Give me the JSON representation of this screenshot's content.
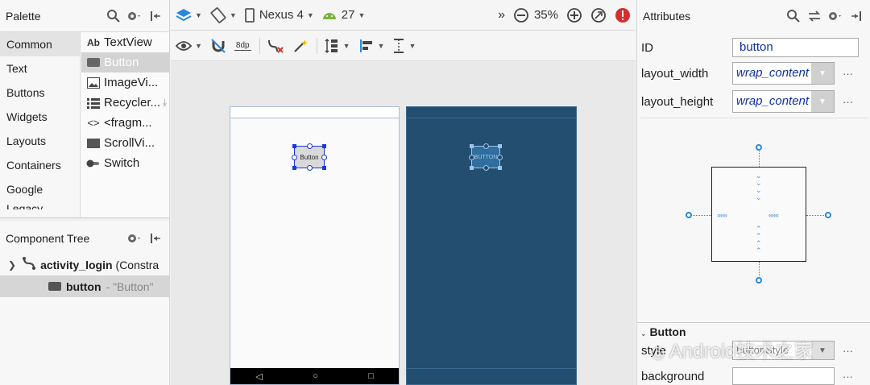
{
  "palette": {
    "title": "Palette",
    "categories": [
      "Common",
      "Text",
      "Buttons",
      "Widgets",
      "Layouts",
      "Containers",
      "Google",
      "Legacy"
    ],
    "selected_category": "Common",
    "items": [
      {
        "label": "TextView",
        "icon": "textview-icon"
      },
      {
        "label": "Button",
        "icon": "button-icon"
      },
      {
        "label": "ImageVi...",
        "icon": "image-icon"
      },
      {
        "label": "Recycler...",
        "icon": "list-icon"
      },
      {
        "label": "<fragm...",
        "icon": "fragment-icon"
      },
      {
        "label": "ScrollVi...",
        "icon": "scrollview-icon"
      },
      {
        "label": "Switch",
        "icon": "switch-icon"
      }
    ],
    "selected_item": "Button"
  },
  "component_tree": {
    "title": "Component Tree",
    "root": {
      "name": "activity_login",
      "type": "(Constra"
    },
    "child": {
      "name": "button",
      "text": "- \"Button\""
    }
  },
  "toolbar": {
    "device": "Nexus 4",
    "api": "27",
    "zoom": "35%",
    "margin": "8dp"
  },
  "preview": {
    "design_button_label": "Button",
    "blueprint_button_label": "BUTTON"
  },
  "attributes": {
    "title": "Attributes",
    "id_label": "ID",
    "id_value": "button",
    "width_label": "layout_width",
    "width_value": "wrap_content",
    "height_label": "layout_height",
    "height_value": "wrap_content",
    "section_title": "Button",
    "style_label": "style",
    "style_value": "buttonStyle",
    "background_label": "background"
  },
  "watermark": "Android技术之家",
  "colors": {
    "accent": "#2b88d8",
    "blueprint": "#234e70",
    "selection": "#1a3bd0"
  }
}
